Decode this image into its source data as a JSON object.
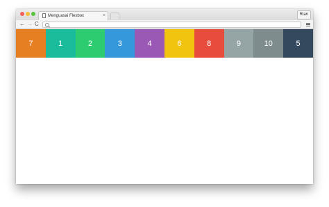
{
  "browser": {
    "tab_title": "Menguasai Flexbox",
    "tab_close": "×",
    "user_label": "Rian",
    "url": "",
    "nav": {
      "back": "←",
      "forward": "→",
      "reload": "C"
    }
  },
  "flex_items": [
    {
      "label": "7",
      "color": "#e67e22"
    },
    {
      "label": "1",
      "color": "#1abc9c"
    },
    {
      "label": "2",
      "color": "#2ecc71"
    },
    {
      "label": "3",
      "color": "#3498db"
    },
    {
      "label": "4",
      "color": "#9b59b6"
    },
    {
      "label": "6",
      "color": "#f1c40f"
    },
    {
      "label": "8",
      "color": "#e74c3c"
    },
    {
      "label": "9",
      "color": "#95a5a6"
    },
    {
      "label": "10",
      "color": "#7f8c8d"
    },
    {
      "label": "5",
      "color": "#34495e"
    }
  ]
}
